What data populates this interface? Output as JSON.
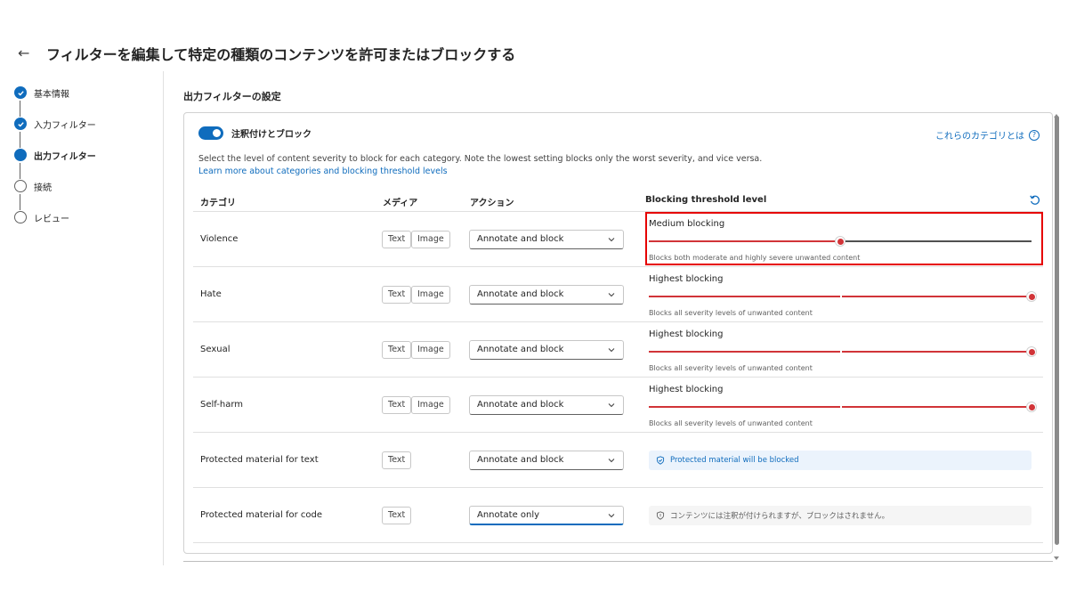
{
  "header": {
    "title": "フィルターを編集して特定の種類のコンテンツを許可またはブロックする"
  },
  "steps": [
    {
      "label": "基本情報",
      "state": "done"
    },
    {
      "label": "入力フィルター",
      "state": "done"
    },
    {
      "label": "出力フィルター",
      "state": "current"
    },
    {
      "label": "接続",
      "state": "todo"
    },
    {
      "label": "レビュー",
      "state": "todo"
    }
  ],
  "section": {
    "title": "出力フィルターの設定"
  },
  "toggle": {
    "label": "注釈付けとブロック",
    "on": true
  },
  "help_link": "これらのカテゴリとは",
  "description": "Select the level of content severity to block for each category. Note the lowest setting blocks only the worst severity, and vice versa.",
  "learn_link": "Learn more about categories and blocking threshold levels",
  "table": {
    "headers": {
      "category": "カテゴリ",
      "media": "メディア",
      "action": "アクション",
      "threshold": "Blocking threshold level"
    },
    "rows": [
      {
        "category": "Violence",
        "media": [
          "Text",
          "Image"
        ],
        "action": "Annotate and block",
        "threshold_title": "Medium blocking",
        "threshold_caption": "Blocks both moderate and highly severe unwanted content",
        "level": 0.5
      },
      {
        "category": "Hate",
        "media": [
          "Text",
          "Image"
        ],
        "action": "Annotate and block",
        "threshold_title": "Highest blocking",
        "threshold_caption": "Blocks all severity levels of unwanted content",
        "level": 1.0
      },
      {
        "category": "Sexual",
        "media": [
          "Text",
          "Image"
        ],
        "action": "Annotate and block",
        "threshold_title": "Highest blocking",
        "threshold_caption": "Blocks all severity levels of unwanted content",
        "level": 1.0
      },
      {
        "category": "Self-harm",
        "media": [
          "Text",
          "Image"
        ],
        "action": "Annotate and block",
        "threshold_title": "Highest blocking",
        "threshold_caption": "Blocks all severity levels of unwanted content",
        "level": 1.0
      },
      {
        "category": "Protected material for text",
        "media": [
          "Text"
        ],
        "action": "Annotate and block",
        "notice": "Protected material will be blocked"
      },
      {
        "category": "Protected material for code",
        "media": [
          "Text"
        ],
        "action": "Annotate only",
        "notice": "コンテンツには注釈が付けられますが、ブロックはされません。"
      }
    ]
  },
  "colors": {
    "accent": "#0f6cbd",
    "slider_fill": "#d13438",
    "highlight": "#e60000"
  }
}
